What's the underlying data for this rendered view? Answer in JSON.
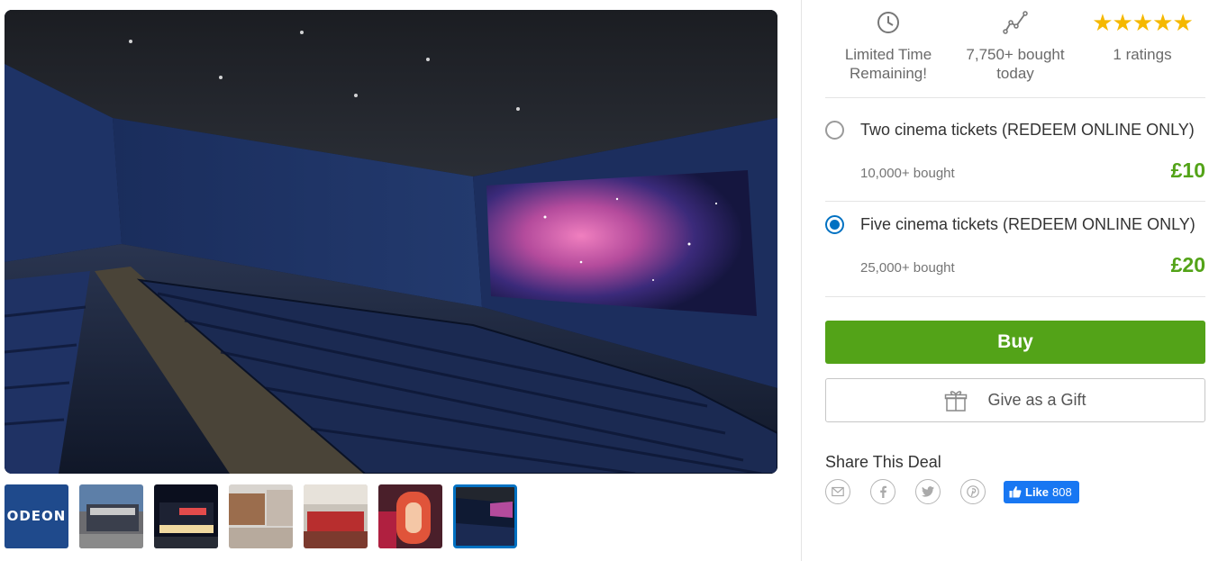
{
  "gallery": {
    "main_image_alt": "Cinema auditorium with galaxy on screen",
    "thumbnails": [
      {
        "name": "odeon-logo",
        "text": "ODEON",
        "selected": false
      },
      {
        "name": "odeon-exterior-day",
        "selected": false
      },
      {
        "name": "odeon-exterior-night",
        "selected": false
      },
      {
        "name": "odeon-foyer",
        "selected": false
      },
      {
        "name": "odeon-restaurant",
        "selected": false
      },
      {
        "name": "odeon-o-sign",
        "selected": false
      },
      {
        "name": "auditorium",
        "selected": true
      }
    ]
  },
  "stats": {
    "time": {
      "icon": "clock-icon",
      "label": "Limited Time Remaining!"
    },
    "bought": {
      "icon": "trend-icon",
      "label": "7,750+ bought today"
    },
    "ratings": {
      "stars": "★★★★★",
      "rating": 5,
      "label": "1 ratings"
    }
  },
  "options": [
    {
      "title": "Two cinema tickets (REDEEM ONLINE ONLY)",
      "bought": "10,000+ bought",
      "price": "£10",
      "selected": false
    },
    {
      "title": "Five cinema tickets (REDEEM ONLINE ONLY)",
      "bought": "25,000+ bought",
      "price": "£20",
      "selected": true
    }
  ],
  "actions": {
    "buy": "Buy",
    "gift": "Give as a Gift"
  },
  "share": {
    "title": "Share This Deal",
    "icons": [
      "mail-icon",
      "facebook-icon",
      "twitter-icon",
      "pinterest-icon"
    ],
    "like_label": "Like",
    "like_count": "808"
  },
  "colors": {
    "accent_green": "#53a318",
    "accent_blue": "#0071c2",
    "star": "#f5b800",
    "facebook": "#1877f2"
  }
}
